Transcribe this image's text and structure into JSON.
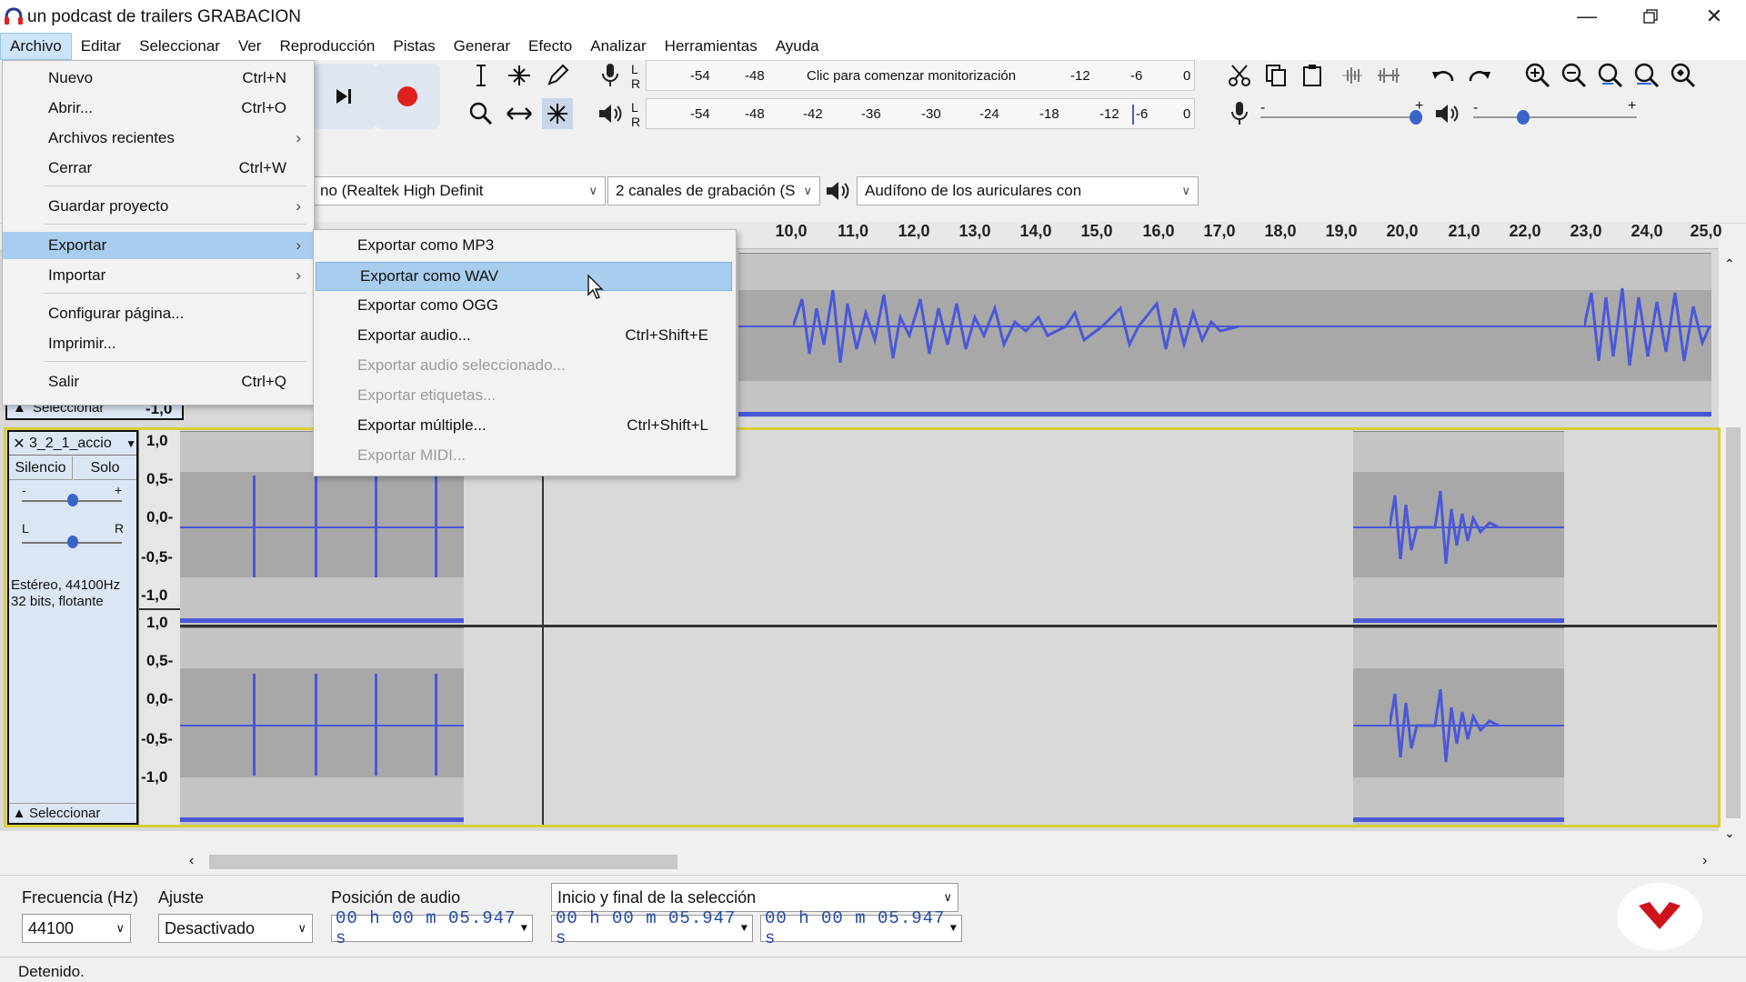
{
  "window": {
    "title": "un podcast de trailers GRABACION",
    "minimize_icon": "minimize-icon",
    "restore_icon": "restore-icon",
    "close_icon": "close-icon"
  },
  "menubar": {
    "items": [
      {
        "label": "Archivo",
        "active": true
      },
      {
        "label": "Editar"
      },
      {
        "label": "Seleccionar"
      },
      {
        "label": "Ver"
      },
      {
        "label": "Reproducción"
      },
      {
        "label": "Pistas"
      },
      {
        "label": "Generar"
      },
      {
        "label": "Efecto"
      },
      {
        "label": "Analizar"
      },
      {
        "label": "Herramientas"
      },
      {
        "label": "Ayuda"
      }
    ]
  },
  "file_menu": {
    "items": [
      {
        "label": "Nuevo",
        "shortcut": "Ctrl+N"
      },
      {
        "label": "Abrir...",
        "shortcut": "Ctrl+O"
      },
      {
        "label": "Archivos recientes",
        "submenu": true
      },
      {
        "label": "Cerrar",
        "shortcut": "Ctrl+W"
      },
      {
        "label": "Guardar proyecto",
        "submenu": true
      },
      {
        "label": "Exportar",
        "submenu": true,
        "highlighted": true
      },
      {
        "label": "Importar",
        "submenu": true
      },
      {
        "label": "Configurar página..."
      },
      {
        "label": "Imprimir..."
      },
      {
        "label": "Salir",
        "shortcut": "Ctrl+Q"
      }
    ]
  },
  "export_menu": {
    "items": [
      {
        "label": "Exportar como MP3"
      },
      {
        "label": "Exportar como WAV",
        "highlighted": true
      },
      {
        "label": "Exportar como OGG"
      },
      {
        "label": "Exportar audio...",
        "shortcut": "Ctrl+Shift+E"
      },
      {
        "label": "Exportar audio seleccionado...",
        "disabled": true
      },
      {
        "label": "Exportar etiquetas...",
        "disabled": true
      },
      {
        "label": "Exportar múltiple...",
        "shortcut": "Ctrl+Shift+L"
      },
      {
        "label": "Exportar MIDI...",
        "disabled": true
      }
    ]
  },
  "meters": {
    "record": {
      "lr_l": "L",
      "lr_r": "R",
      "ticks": [
        "-54",
        "-48"
      ],
      "hint": "Clic para comenzar monitorización",
      "ticks_right": [
        "-12",
        "-6",
        "0"
      ]
    },
    "play": {
      "lr_l": "L",
      "lr_r": "R",
      "ticks": [
        "-54",
        "-48",
        "-42",
        "-36",
        "-30",
        "-24",
        "-18",
        "-12",
        "-6",
        "0"
      ]
    }
  },
  "sliders": {
    "rec_minus": "-",
    "rec_plus": "+",
    "play_minus": "-",
    "play_plus": "+"
  },
  "devices": {
    "input": "no (Realtek High Definit",
    "channels": "2 canales de grabación (S",
    "output": "Audífono de los auriculares con"
  },
  "ruler": {
    "labels": [
      "10,0",
      "11,0",
      "12,0",
      "13,0",
      "14,0",
      "15,0",
      "16,0",
      "17,0",
      "18,0",
      "19,0",
      "20,0",
      "21,0",
      "22,0",
      "23,0",
      "24,0",
      "25,0"
    ]
  },
  "track1": {
    "select_label": "Seleccionar",
    "scale_bottom": "-1,0"
  },
  "track2": {
    "name": "3_2_1_accio",
    "mute": "Silencio",
    "solo": "Solo",
    "gain_minus": "-",
    "gain_plus": "+",
    "pan_l": "L",
    "pan_r": "R",
    "info_line1": "Estéreo, 44100Hz",
    "info_line2": "32 bits, flotante",
    "select_label": "Seleccionar",
    "scale_top": [
      "1,0",
      "0,5-",
      "0,0-",
      "-0,5-",
      "-1,0"
    ],
    "scale_bottom": [
      "1,0",
      "0,5-",
      "0,0-",
      "-0,5-",
      "-1,0"
    ]
  },
  "bottom": {
    "rate_label": "Frecuencia (Hz)",
    "rate_value": "44100",
    "snap_label": "Ajuste",
    "snap_value": "Desactivado",
    "position_label": "Posición de audio",
    "position_value": "00 h 00 m 05.947 s",
    "selection_label": "Inicio y final de la selección",
    "sel_start": "00 h 00 m 05.947 s",
    "sel_end": "00 h 00 m 05.947 s",
    "status": "Detenido."
  },
  "colors": {
    "waveform": "#4a58d8",
    "highlight": "#a9cdef",
    "record": "#e0201e",
    "logo": "#d0121b"
  }
}
